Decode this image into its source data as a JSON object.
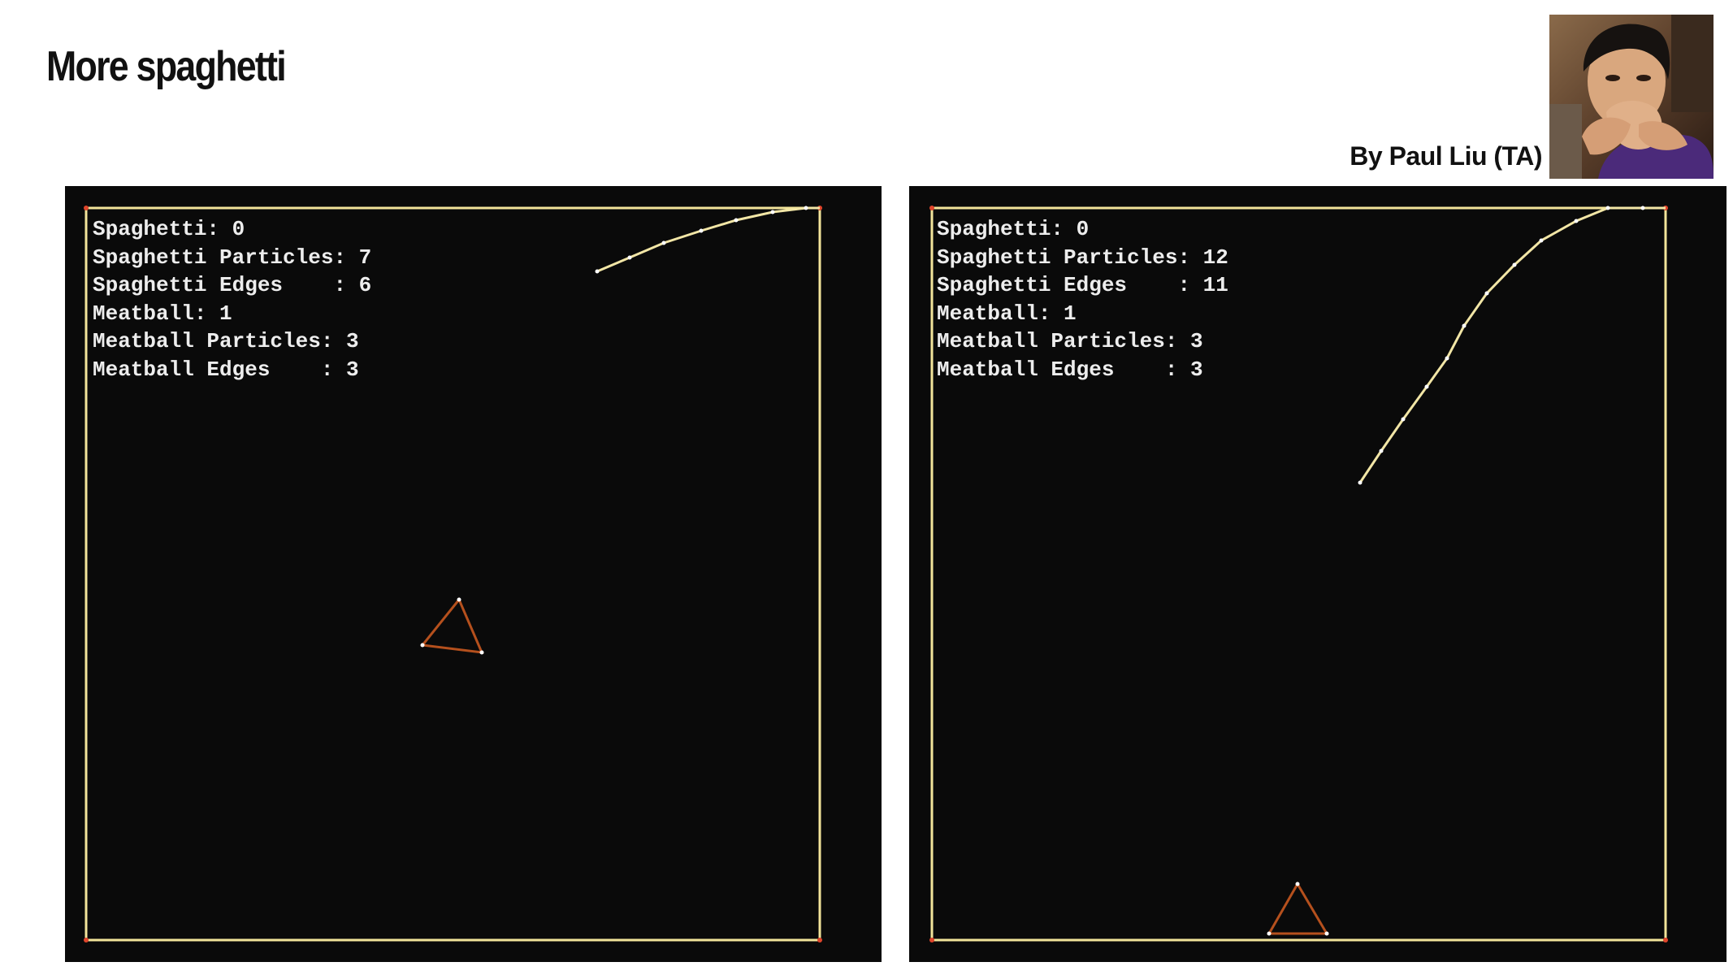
{
  "slide": {
    "title": "More spaghetti",
    "credit": "By Paul Liu (TA)"
  },
  "panels": [
    {
      "stats": [
        "Spaghetti: 0",
        "Spaghetti Particles: 7",
        "Spaghetti Edges    : 6",
        "Meatball: 1",
        "Meatball Particles: 3",
        "Meatball Edges    : 3"
      ]
    },
    {
      "stats": [
        "Spaghetti: 0",
        "Spaghetti Particles: 12",
        "Spaghetti Edges    : 11",
        "Meatball: 1",
        "Meatball Particles: 3",
        "Meatball Edges    : 3"
      ]
    }
  ],
  "colors": {
    "slide_background": "#ffffff",
    "sim_background": "#0a0a0a",
    "boundary": "#f2e49a",
    "spaghetti": "#f2e6a6",
    "meatball": "#b5501d",
    "particle": "#ffffff",
    "corner_particle": "#e0452b",
    "stats_text": "#ededed"
  }
}
